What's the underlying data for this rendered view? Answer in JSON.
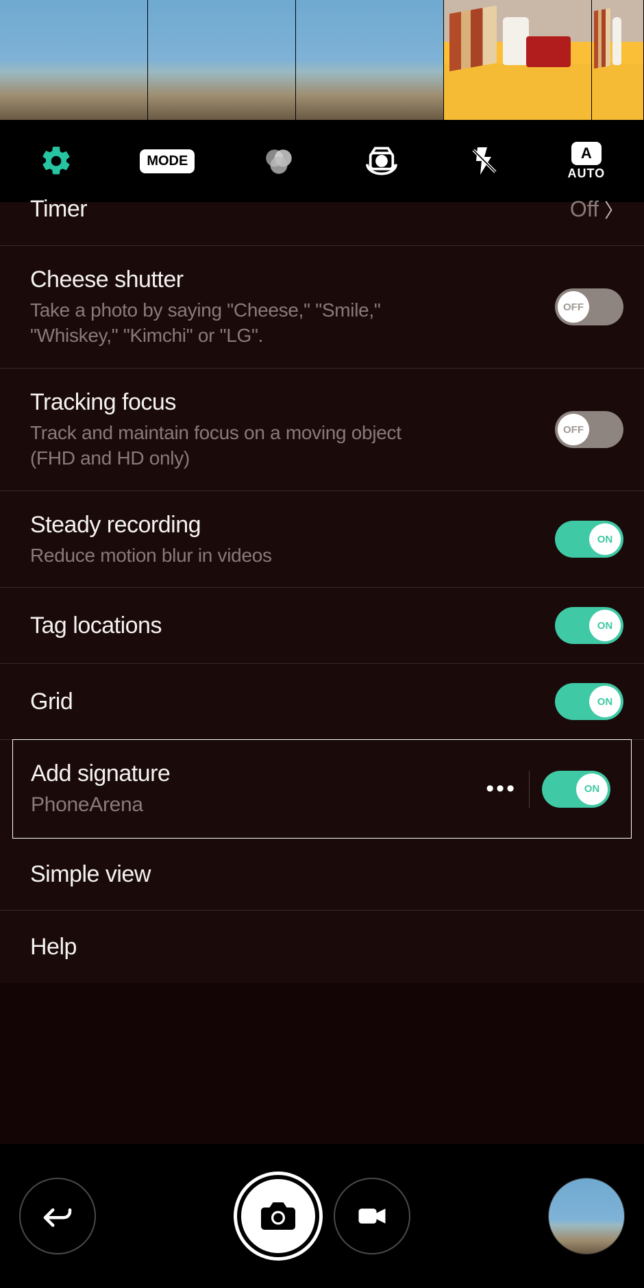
{
  "toolbar": {
    "mode_label": "MODE",
    "auto_label": "AUTO",
    "auto_badge": "A"
  },
  "settings": {
    "timer": {
      "title": "Timer",
      "value": "Off"
    },
    "cheese": {
      "title": "Cheese shutter",
      "sub": "Take a photo by saying \"Cheese,\" \"Smile,\" \"Whiskey,\" \"Kimchi\" or \"LG\".",
      "on": false
    },
    "tracking": {
      "title": "Tracking focus",
      "sub": "Track and maintain focus on a moving object (FHD and HD only)",
      "on": false
    },
    "steady": {
      "title": "Steady recording",
      "sub": "Reduce motion blur in videos",
      "on": true
    },
    "tag": {
      "title": "Tag locations",
      "on": true
    },
    "grid": {
      "title": "Grid",
      "on": true
    },
    "signature": {
      "title": "Add signature",
      "sub": "PhoneArena",
      "on": true
    },
    "simple": {
      "title": "Simple view"
    },
    "help": {
      "title": "Help"
    }
  },
  "toggle_labels": {
    "on": "ON",
    "off": "OFF"
  }
}
